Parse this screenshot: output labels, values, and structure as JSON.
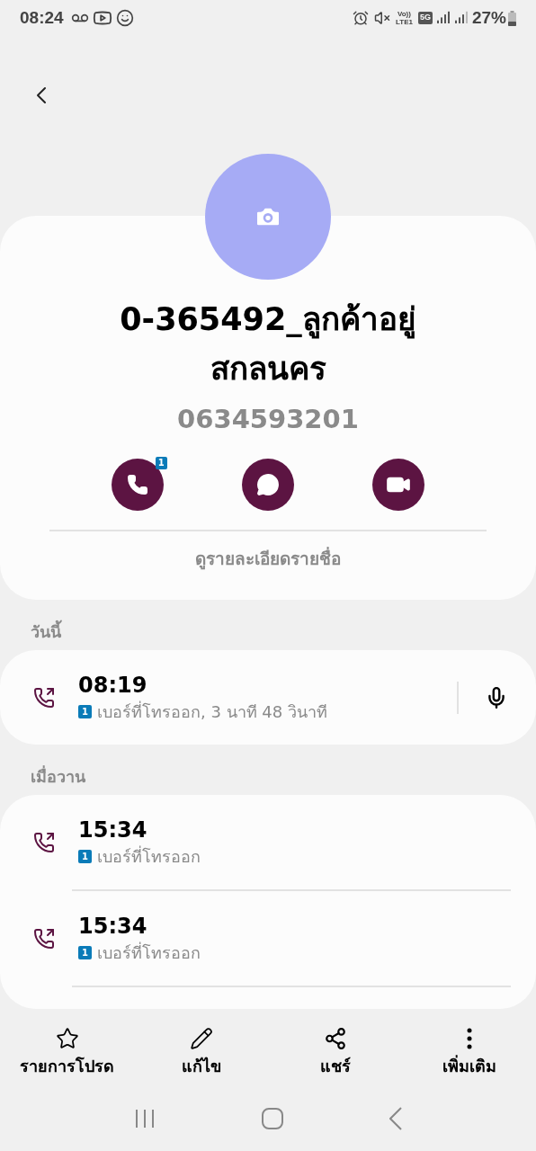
{
  "status_bar": {
    "time": "08:24",
    "volte": "Vo))",
    "lte": "LTE1",
    "network": "5G",
    "battery": "27%"
  },
  "contact": {
    "name_lines": [
      "0-365492_ลูกค้าอยู่",
      "สกลนคร"
    ],
    "number": "0634593201",
    "call_badge": "1",
    "details_link": "ดูรายละเอียดรายชื่อ"
  },
  "history": [
    {
      "heading": "วันนี้",
      "calls": [
        {
          "kind": "outgoing",
          "time": "08:19",
          "sim": "1",
          "detail": "เบอร์ที่โทรออก, 3 นาที 48 วินาที",
          "recording": true
        }
      ]
    },
    {
      "heading": "เมื่อวาน",
      "calls": [
        {
          "kind": "outgoing",
          "time": "15:34",
          "sim": "1",
          "detail": "เบอร์ที่โทรออก",
          "recording": false
        },
        {
          "kind": "outgoing",
          "time": "15:34",
          "sim": "1",
          "detail": "เบอร์ที่โทรออก",
          "recording": false
        }
      ]
    }
  ],
  "bottom_actions": [
    {
      "kind": "favorite",
      "label": "รายการโปรด"
    },
    {
      "kind": "edit",
      "label": "แก้ไข"
    },
    {
      "kind": "share",
      "label": "แชร์"
    },
    {
      "kind": "more",
      "label": "เพิ่มเติม"
    }
  ]
}
